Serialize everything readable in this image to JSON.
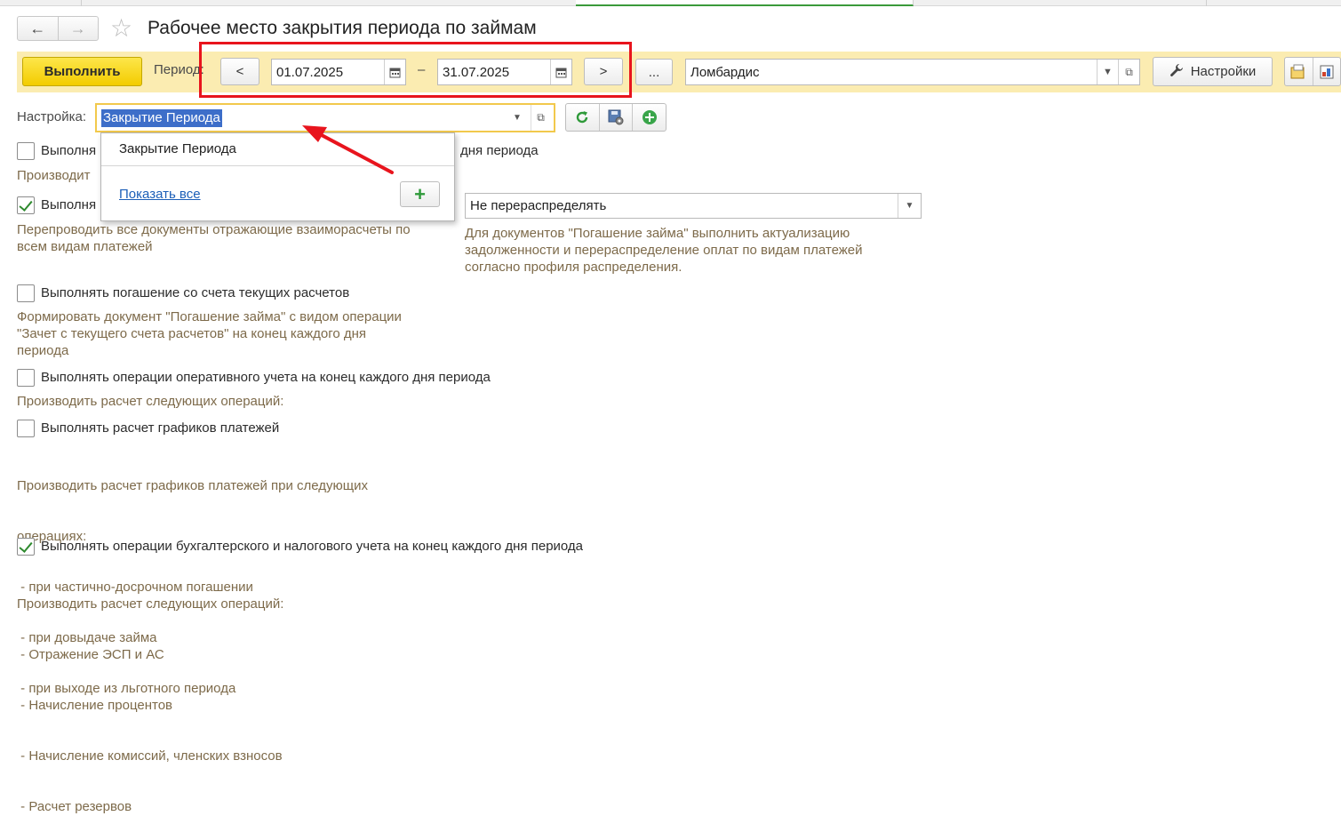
{
  "header": {
    "back_icon": "arrow-left-icon",
    "forward_icon": "arrow-right-icon",
    "favorite_icon": "star-outline-icon",
    "title": "Рабочее место закрытия периода по займам"
  },
  "toolbar": {
    "execute_label": "Выполнить",
    "period_label": "Период:",
    "prev_label": "<",
    "date_from": "01.07.2025",
    "dash": "–",
    "date_to": "31.07.2025",
    "next_label": ">",
    "more_label": "...",
    "organization": "Ломбардис",
    "settings_label": "Настройки"
  },
  "settings": {
    "label": "Настройка:",
    "value": "Закрытие Периода"
  },
  "popup": {
    "item": "Закрытие Периода",
    "show_all": "Показать все"
  },
  "options": [
    {
      "text": "Выполня",
      "tail": "дня периода",
      "checked": false,
      "hint": "Производит"
    },
    {
      "text": "Выполня",
      "checked": true,
      "hint_lines": [
        "Перепроводить все документы отражающие взаиморасчеты по",
        "всем видам платежей"
      ],
      "select_value": "Не перераспределять",
      "select_hint_lines": [
        "Для документов \"Погашение займа\" выполнить актуализацию",
        "задолженности и перераспределение оплат по видам платежей",
        "согласно профиля распределения."
      ]
    },
    {
      "text": "Выполнять погашение со счета текущих расчетов",
      "checked": false,
      "hint_lines": [
        "Формировать документ \"Погашение займа\" с видом операции",
        "\"Зачет с текущего счета расчетов\" на конец каждого дня",
        "периода"
      ]
    },
    {
      "text": "Выполнять операции оперативного учета на конец каждого дня периода",
      "checked": false,
      "hint_lines": [
        "Производить расчет следующих операций:"
      ]
    },
    {
      "text": "Выполнять расчет графиков платежей",
      "checked": false,
      "hint_lines": [
        "Производить расчет графиков платежей при следующих",
        "операциях:",
        " - при частично-досрочном погашении",
        " - при довыдаче займа",
        " - при выходе из льготного периода"
      ]
    },
    {
      "text": "Выполнять операции бухгалтерского и налогового учета на конец каждого дня периода",
      "checked": true,
      "hint_lines": [
        "Производить расчет следующих операций:",
        " - Отражение ЭСП и АС",
        " - Начисление процентов",
        " - Начисление комиссий, членских взносов",
        " - Расчет резервов"
      ]
    }
  ],
  "colors": {
    "command_bar": "#fbecb1",
    "execute_button": "#f3cc00",
    "highlight_frame": "#e8141d",
    "selection": "#3d6ec9",
    "hint_text": "#7d6a4a",
    "link": "#1c5fb8"
  }
}
